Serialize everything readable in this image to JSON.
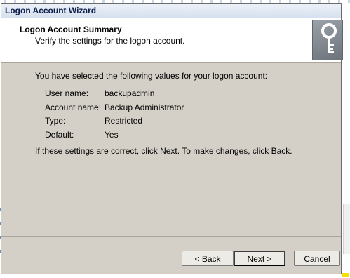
{
  "window": {
    "title": "Logon Account Wizard"
  },
  "header": {
    "title": "Logon Account Summary",
    "subtitle": "Verify the settings for the logon account.",
    "icon": "key-icon"
  },
  "content": {
    "intro": "You have selected the following values for your logon account:",
    "fields": [
      {
        "label": "User name:",
        "value": "backupadmin"
      },
      {
        "label": "Account name:",
        "value": "Backup Administrator"
      },
      {
        "label": "Type:",
        "value": "Restricted"
      },
      {
        "label": "Default:",
        "value": "Yes"
      }
    ],
    "outro": "If these settings are correct, click Next.  To make changes, click Back."
  },
  "buttons": {
    "back": "< Back",
    "next": "Next >",
    "cancel": "Cancel"
  }
}
